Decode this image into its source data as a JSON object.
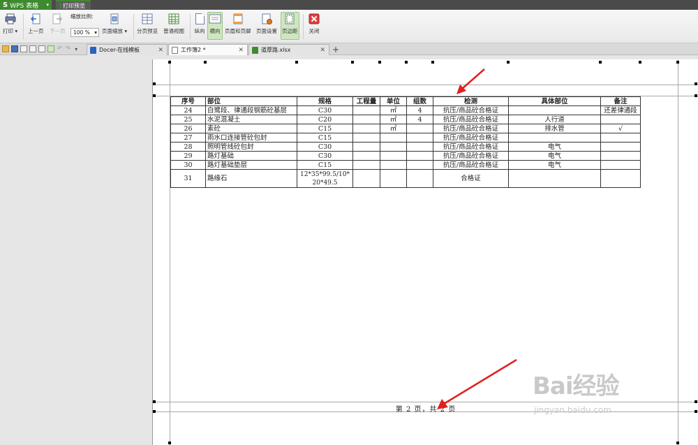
{
  "titlebar": {
    "app_name": "WPS 表格",
    "ribbon_tab": "打印预览"
  },
  "toolbar": {
    "print": "打印",
    "prev_page": "上一页",
    "next_page": "下一页",
    "zoom_label": "缩放比例:",
    "zoom_value": "100 %",
    "page_zoom": "页面缩放",
    "page_break_preview": "分页预览",
    "normal_view": "普通视图",
    "portrait": "纵向",
    "landscape": "横向",
    "header_footer": "页眉和页脚",
    "page_setup": "页面设置",
    "margins": "页边距",
    "close": "关闭"
  },
  "tabs": [
    {
      "label": "Docer-在线模板"
    },
    {
      "label": "工作簿2 *"
    },
    {
      "label": "道厚路.xlsx"
    }
  ],
  "table": {
    "headers": [
      "序号",
      "部位",
      "规格",
      "工程量",
      "单位",
      "组数",
      "检测",
      "具体部位",
      "备注"
    ],
    "rows": [
      [
        "24",
        "白鹭段、律通段钢筋砼基层",
        "C30",
        "",
        "㎡",
        "4",
        "抗压/商品砼合格证",
        "",
        "还差律通段"
      ],
      [
        "25",
        "水泥混凝土",
        "C20",
        "",
        "㎡",
        "4",
        "抗压/商品砼合格证",
        "人行道",
        ""
      ],
      [
        "26",
        "素砼",
        "C15",
        "",
        "㎡",
        "",
        "抗压/商品砼合格证",
        "排水管",
        "√"
      ],
      [
        "27",
        "雨水口连接管砼包封",
        "C15",
        "",
        "",
        "",
        "抗压/商品砼合格证",
        "",
        ""
      ],
      [
        "28",
        "照明管线砼包封",
        "C30",
        "",
        "",
        "",
        "抗压/商品砼合格证",
        "电气",
        ""
      ],
      [
        "29",
        "路灯基础",
        "C30",
        "",
        "",
        "",
        "抗压/商品砼合格证",
        "电气",
        ""
      ],
      [
        "30",
        "路灯基础垫层",
        "C15",
        "",
        "",
        "",
        "抗压/商品砼合格证",
        "电气",
        ""
      ],
      [
        "31",
        "路缘石",
        "12*35*99.5/10*20*49.5",
        "",
        "",
        "",
        "合格证",
        "",
        ""
      ]
    ]
  },
  "footer": {
    "page_info": "第 2 页，共 2 页"
  },
  "watermark": {
    "brand": "Bai经验",
    "url": "jingyan.baidu.com"
  },
  "colors": {
    "accent_green": "#3f8a2f",
    "arrow_red": "#e02020"
  }
}
